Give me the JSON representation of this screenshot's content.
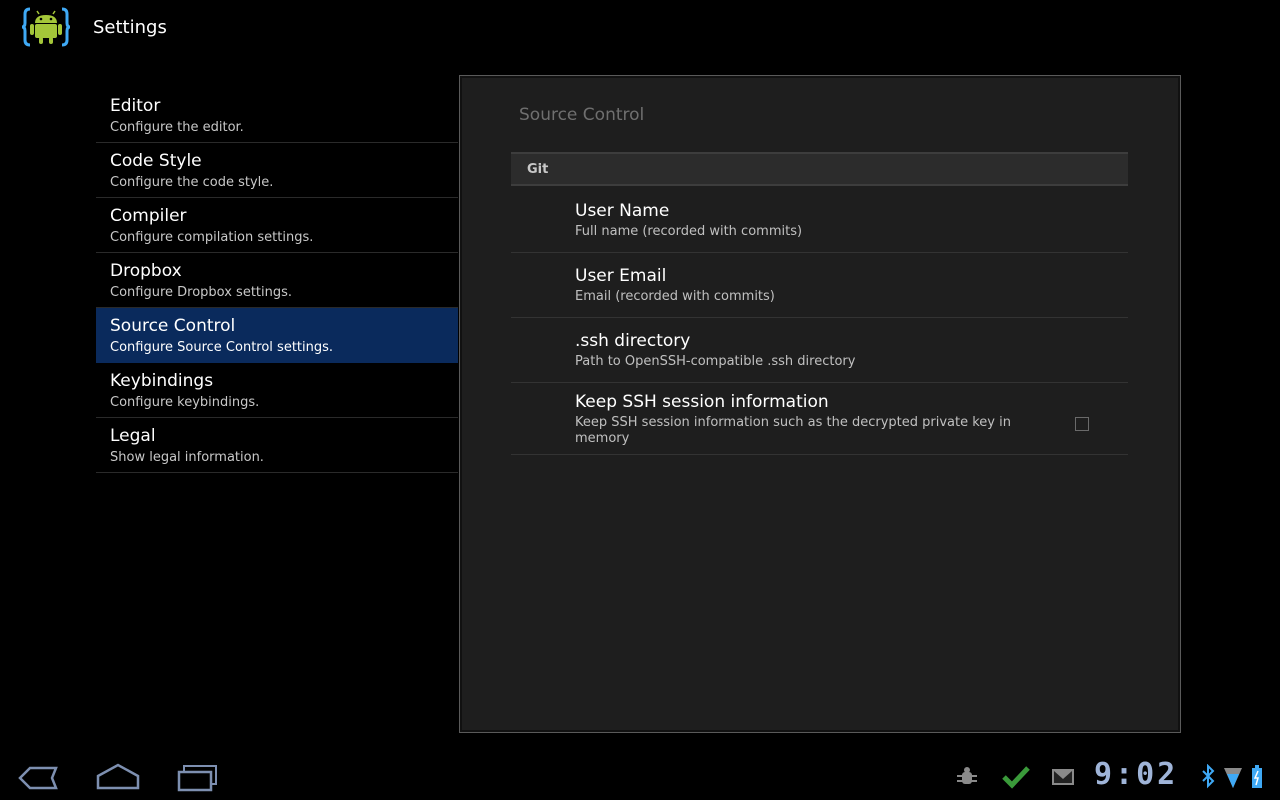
{
  "actionbar": {
    "title": "Settings"
  },
  "headers": [
    {
      "title": "Editor",
      "summary": "Configure the editor."
    },
    {
      "title": "Code Style",
      "summary": "Configure the code style."
    },
    {
      "title": "Compiler",
      "summary": "Configure compilation settings."
    },
    {
      "title": "Dropbox",
      "summary": "Configure Dropbox settings."
    },
    {
      "title": "Source Control",
      "summary": "Configure Source Control settings.",
      "selected": true
    },
    {
      "title": "Keybindings",
      "summary": "Configure keybindings."
    },
    {
      "title": "Legal",
      "summary": "Show legal information."
    }
  ],
  "panel": {
    "title": "Source Control",
    "category": "Git",
    "prefs": [
      {
        "title": "User Name",
        "summary": "Full name (recorded with commits)"
      },
      {
        "title": "User Email",
        "summary": "Email (recorded with commits)"
      },
      {
        "title": ".ssh directory",
        "summary": "Path to OpenSSH-compatible .ssh directory"
      },
      {
        "title": "Keep SSH session information",
        "summary_line1": "Keep SSH session information such as the decrypted private key in",
        "summary_line2": "memory",
        "checked": false
      }
    ]
  },
  "systembar": {
    "clock": "9:02",
    "icons": [
      "back-icon",
      "home-icon",
      "recent-apps-icon",
      "usb-debugging-icon",
      "check-icon",
      "gmail-icon",
      "bluetooth-icon",
      "wifi-icon",
      "battery-icon"
    ]
  },
  "colors": {
    "selected": "#0a2a5c",
    "panel_bg": "#1e1e1e",
    "clock": "#9fb4d8"
  }
}
